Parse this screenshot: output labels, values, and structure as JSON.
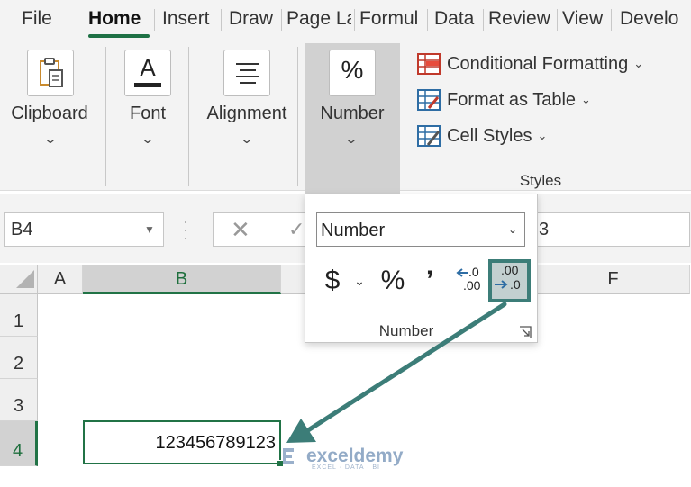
{
  "tabs": [
    "File",
    "Home",
    "Insert",
    "Draw",
    "Page La",
    "Formul",
    "Data",
    "Review",
    "View",
    "Develo"
  ],
  "ribbon": {
    "clipboard_label": "Clipboard",
    "font_label": "Font",
    "font_icon_letter": "A",
    "alignment_label": "Alignment",
    "number_label": "Number",
    "number_icon": "%",
    "styles_items": [
      "Conditional Formatting",
      "Format as Table",
      "Cell Styles"
    ],
    "styles_group_label": "Styles"
  },
  "formula_bar": {
    "name_box": "B4",
    "value_visible": "3"
  },
  "number_panel": {
    "format_selected": "Number",
    "currency_symbol": "$",
    "percent_symbol": "%",
    "comma_symbol": "’",
    "increase_decimal_top": ".0",
    "increase_decimal_bottom": ".00",
    "decrease_decimal_top": ".00",
    "decrease_decimal_bottom": ".0",
    "group_label": "Number"
  },
  "grid": {
    "columns": [
      "A",
      "B",
      "F"
    ],
    "rows": [
      "1",
      "2",
      "3",
      "4"
    ],
    "active_cell_value": "123456789123"
  },
  "watermark": {
    "name": "exceldemy",
    "tagline": "EXCEL · DATA · BI"
  },
  "colors": {
    "excel_green": "#217346",
    "annotation_teal": "#3c7d78",
    "ribbon_bg": "#f3f3f3"
  }
}
